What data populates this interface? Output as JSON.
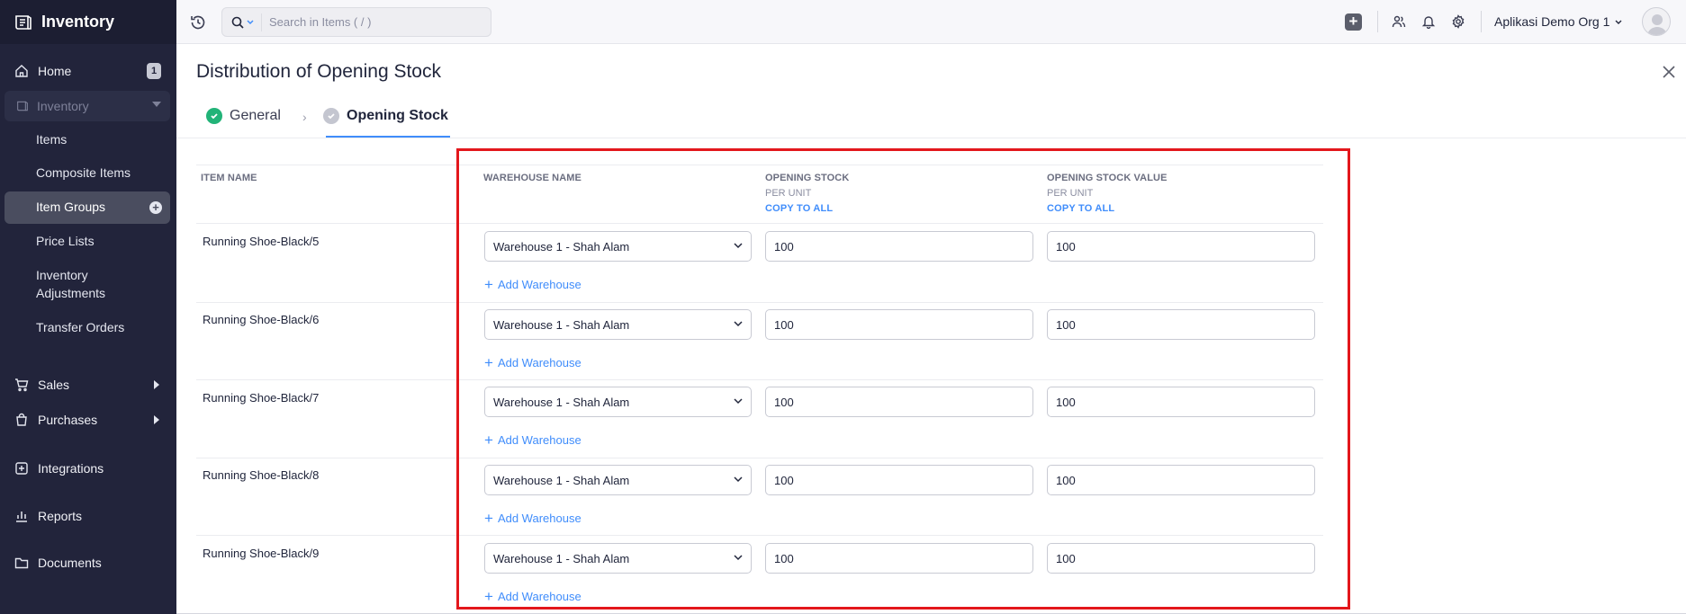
{
  "app": {
    "name": "Inventory"
  },
  "sidebar": {
    "home": {
      "label": "Home",
      "badge": "1"
    },
    "inventory": {
      "label": "Inventory"
    },
    "sub_items": [
      {
        "label": "Items"
      },
      {
        "label": "Composite Items"
      },
      {
        "label": "Item Groups"
      },
      {
        "label": "Price Lists"
      },
      {
        "label": "Inventory Adjustments"
      },
      {
        "label": "Transfer Orders"
      }
    ],
    "sales": {
      "label": "Sales"
    },
    "purchases": {
      "label": "Purchases"
    },
    "integrations": {
      "label": "Integrations"
    },
    "reports": {
      "label": "Reports"
    },
    "documents": {
      "label": "Documents"
    }
  },
  "header": {
    "search_placeholder": "Search in Items ( / )",
    "org_name": "Aplikasi Demo Org 1"
  },
  "page": {
    "title": "Distribution of Opening Stock",
    "steps": [
      {
        "label": "General"
      },
      {
        "label": "Opening Stock"
      }
    ]
  },
  "table": {
    "col_item": "ITEM NAME",
    "col_warehouse": "WAREHOUSE NAME",
    "col_stock": "OPENING STOCK",
    "col_stock_sub": "PER UNIT",
    "col_value": "OPENING STOCK VALUE",
    "col_value_sub": "PER UNIT",
    "copy_all": "COPY TO ALL",
    "add_warehouse": "Add Warehouse",
    "rows": [
      {
        "item": "Running Shoe-Black/5",
        "warehouse": "Warehouse 1 - Shah Alam",
        "stock": "100",
        "value": "100"
      },
      {
        "item": "Running Shoe-Black/6",
        "warehouse": "Warehouse 1 - Shah Alam",
        "stock": "100",
        "value": "100"
      },
      {
        "item": "Running Shoe-Black/7",
        "warehouse": "Warehouse 1 - Shah Alam",
        "stock": "100",
        "value": "100"
      },
      {
        "item": "Running Shoe-Black/8",
        "warehouse": "Warehouse 1 - Shah Alam",
        "stock": "100",
        "value": "100"
      },
      {
        "item": "Running Shoe-Black/9",
        "warehouse": "Warehouse 1 - Shah Alam",
        "stock": "100",
        "value": "100"
      }
    ]
  },
  "colors": {
    "accent": "#408dfb",
    "sidebar_bg": "#22243b",
    "success": "#22b378",
    "highlight": "#e3171c"
  }
}
